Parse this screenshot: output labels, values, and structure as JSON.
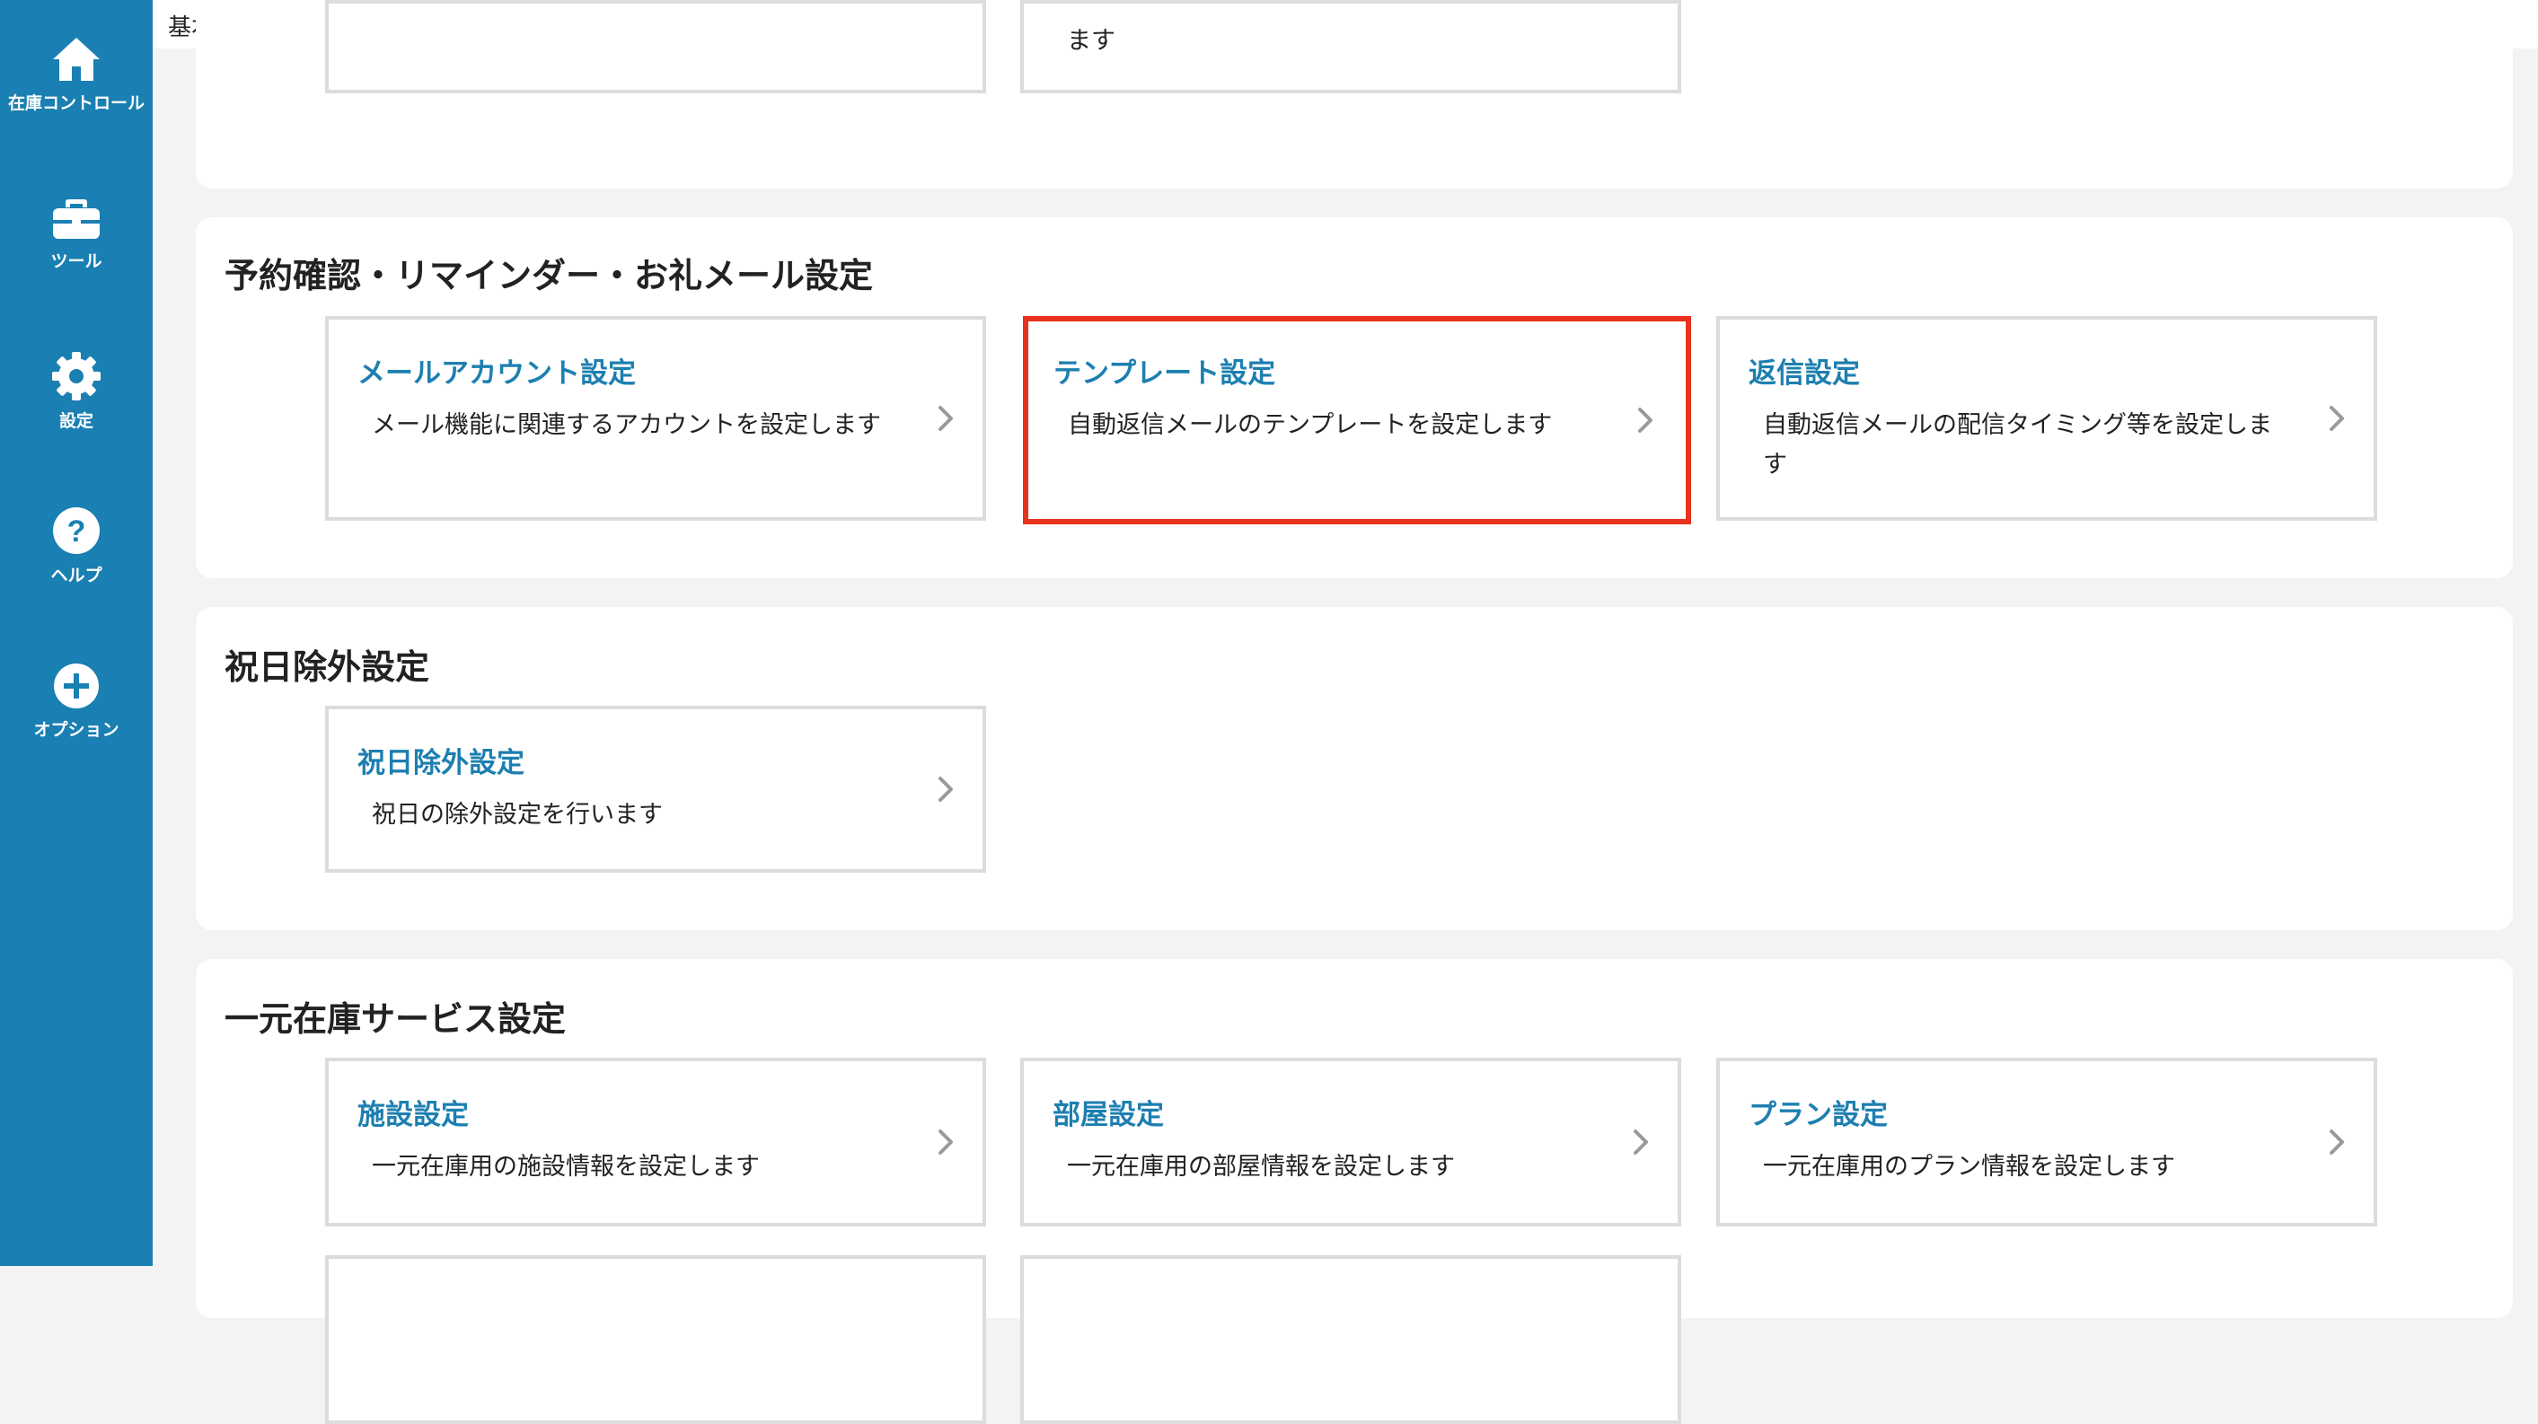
{
  "sidebar": {
    "items": [
      {
        "label": "在庫コントロール",
        "icon": "home-icon"
      },
      {
        "label": "ツール",
        "icon": "toolbox-icon"
      },
      {
        "label": "設定",
        "icon": "gear-icon"
      },
      {
        "label": "ヘルプ",
        "icon": "help-icon"
      },
      {
        "label": "オプション",
        "icon": "plus-circle-icon"
      }
    ]
  },
  "header": {
    "title": "基本設定"
  },
  "sections": {
    "top": {
      "cards": [
        {
          "desc": ""
        },
        {
          "desc": "ます"
        }
      ]
    },
    "reservation_mail": {
      "title": "予約確認・リマインダー・お礼メール設定",
      "cards": [
        {
          "title": "メールアカウント設定",
          "desc": "メール機能に関連するアカウントを設定します"
        },
        {
          "title": "テンプレート設定",
          "desc": "自動返信メールのテンプレートを設定します"
        },
        {
          "title": "返信設定",
          "desc": "自動返信メールの配信タイミング等を設定します"
        }
      ]
    },
    "holiday": {
      "title": "祝日除外設定",
      "cards": [
        {
          "title": "祝日除外設定",
          "desc": "祝日の除外設定を行います"
        }
      ]
    },
    "inventory_service": {
      "title": "一元在庫サービス設定",
      "cards": [
        {
          "title": "施設設定",
          "desc": "一元在庫用の施設情報を設定します"
        },
        {
          "title": "部屋設定",
          "desc": "一元在庫用の部屋情報を設定します"
        },
        {
          "title": "プラン設定",
          "desc": "一元在庫用のプラン情報を設定します"
        }
      ]
    }
  },
  "colors": {
    "sidebar": "#1a7fb2",
    "link": "#1d7fb0",
    "highlight": "#e8321c",
    "card_border": "#dcdcdc"
  }
}
